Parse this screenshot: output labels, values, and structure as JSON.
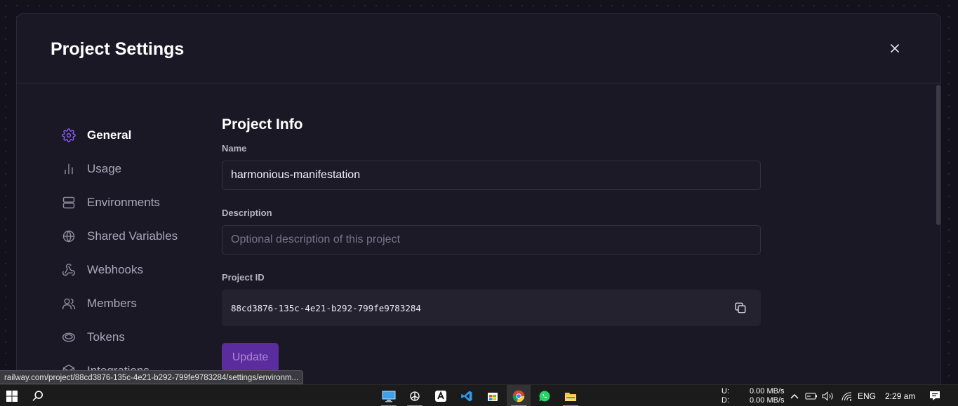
{
  "modal": {
    "title": "Project Settings"
  },
  "sidebar": {
    "items": [
      {
        "label": "General",
        "icon": "gear-icon",
        "active": true
      },
      {
        "label": "Usage",
        "icon": "bar-chart-icon"
      },
      {
        "label": "Environments",
        "icon": "server-icon"
      },
      {
        "label": "Shared Variables",
        "icon": "globe-icon"
      },
      {
        "label": "Webhooks",
        "icon": "webhook-icon"
      },
      {
        "label": "Members",
        "icon": "users-icon"
      },
      {
        "label": "Tokens",
        "icon": "token-icon"
      },
      {
        "label": "Integrations",
        "icon": "box-icon"
      }
    ]
  },
  "project_info": {
    "section_title": "Project Info",
    "name_label": "Name",
    "name_value": "harmonious-manifestation",
    "description_label": "Description",
    "description_value": "",
    "description_placeholder": "Optional description of this project",
    "id_label": "Project ID",
    "id_value": "88cd3876-135c-4e21-b292-799fe9783284",
    "update_label": "Update"
  },
  "browser": {
    "status_url": "railway.com/project/88cd3876-135c-4e21-b292-799fe9783284/settings/environm..."
  },
  "taskbar": {
    "net_upload_label": "U:",
    "net_download_label": "D:",
    "net_upload_value": "0.00 MB/s",
    "net_download_value": "0.00 MB/s",
    "language": "ENG",
    "time": "2:29 am"
  },
  "colors": {
    "accent": "#8b5cf6",
    "background": "#13111c",
    "modal": "#1a1825",
    "update_button": "#5b2c9e"
  }
}
